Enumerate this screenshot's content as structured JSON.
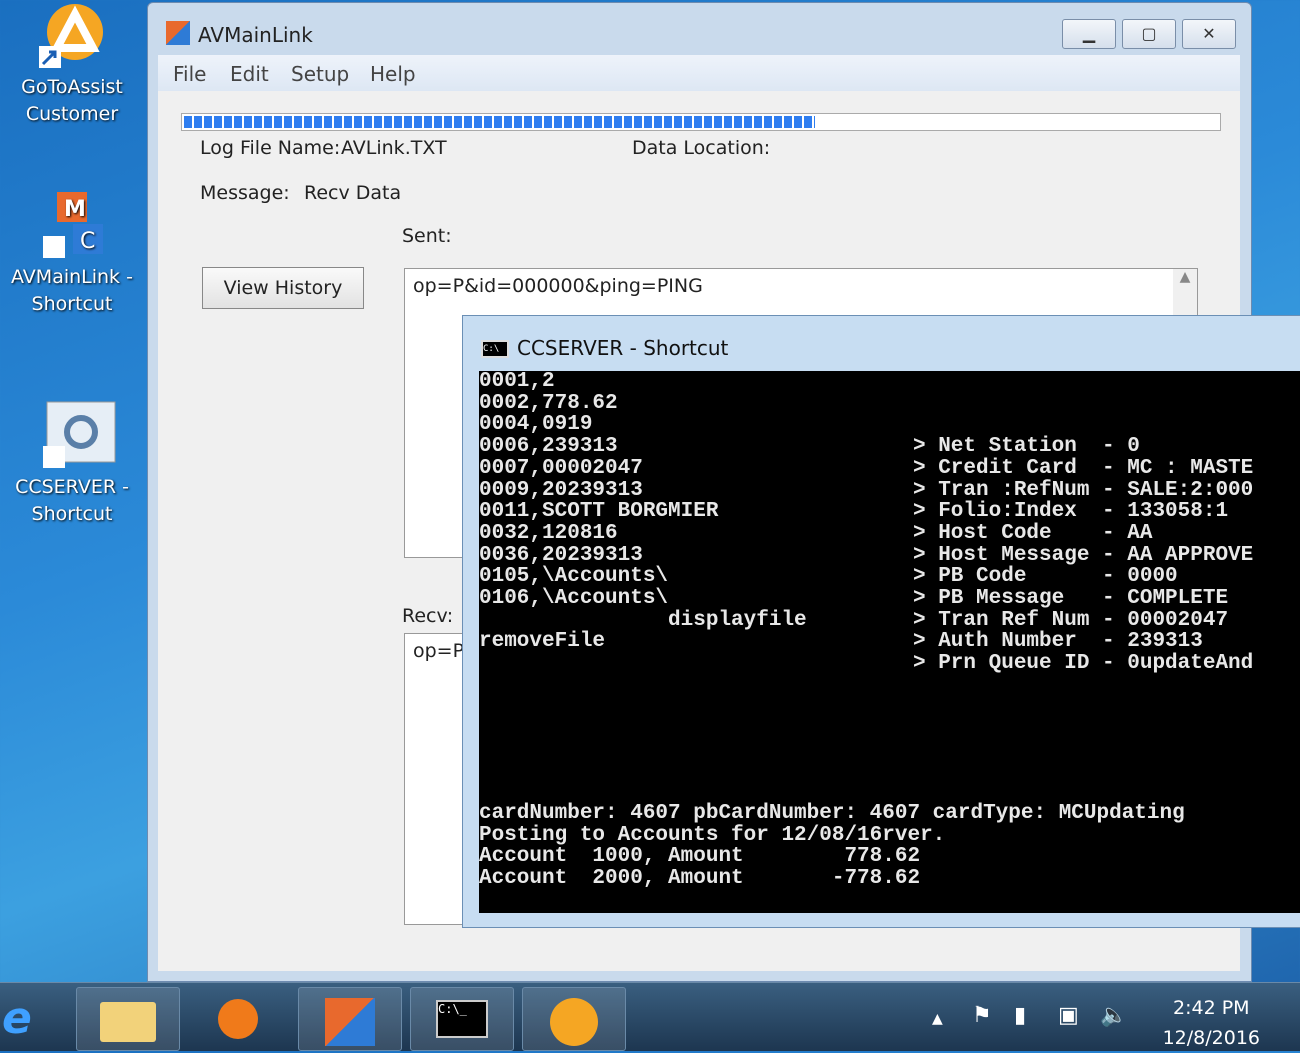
{
  "desktop": {
    "icons": [
      {
        "label1": "GoToAssist",
        "label2": "Customer",
        "icon": "gotoassist-icon"
      },
      {
        "label1": "AVMainLink -",
        "label2": "Shortcut",
        "icon": "avmainlink-icon"
      },
      {
        "label1": "CCSERVER -",
        "label2": "Shortcut",
        "icon": "ccserver-icon"
      }
    ]
  },
  "main_window": {
    "title": "AVMainLink",
    "menu": [
      "File",
      "Edit",
      "Setup",
      "Help"
    ],
    "progress_percent": 61,
    "log_file_label": "Log File Name:",
    "log_file_value": "AVLink.TXT",
    "data_location_label": "Data Location:",
    "message_label": "Message:",
    "message_value": "Recv Data",
    "sent_label": "Sent:",
    "sent_value": "op=P&id=000000&ping=PING",
    "recv_label": "Recv:",
    "recv_value": "op=P",
    "view_history": "View History"
  },
  "console": {
    "title": "CCSERVER - Shortcut",
    "left": [
      "0001,2",
      "0002,778.62",
      "0004,0919",
      "0006,239313",
      "0007,00002047",
      "0009,20239313",
      "0011,SCOTT BORGMIER",
      "0032,120816",
      "0036,20239313",
      "0105,\\Accounts\\",
      "0106,\\Accounts\\",
      "               displayfile",
      "removeFile",
      ""
    ],
    "right": [
      "",
      "",
      "",
      "> Net Station  - 0",
      "> Credit Card  - MC : MASTE",
      "> Tran :RefNum - SALE:2:000",
      "> Folio:Index  - 133058:1",
      "> Host Code    - AA",
      "> Host Message - AA APPROVE",
      "> PB Code      - 0000",
      "> PB Message   - COMPLETE",
      "> Tran Ref Num - 00002047",
      "> Auth Number  - 239313",
      "> Prn Queue ID - 0updateAnd"
    ],
    "bottom": [
      "cardNumber: 4607 pbCardNumber: 4607 cardType: MCUpdating",
      "Posting to Accounts for 12/08/16rver.",
      "Account  1000, Amount        778.62",
      "Account  2000, Amount       -778.62"
    ]
  },
  "taskbar": {
    "time": "2:42 PM",
    "date": "12/8/2016"
  }
}
